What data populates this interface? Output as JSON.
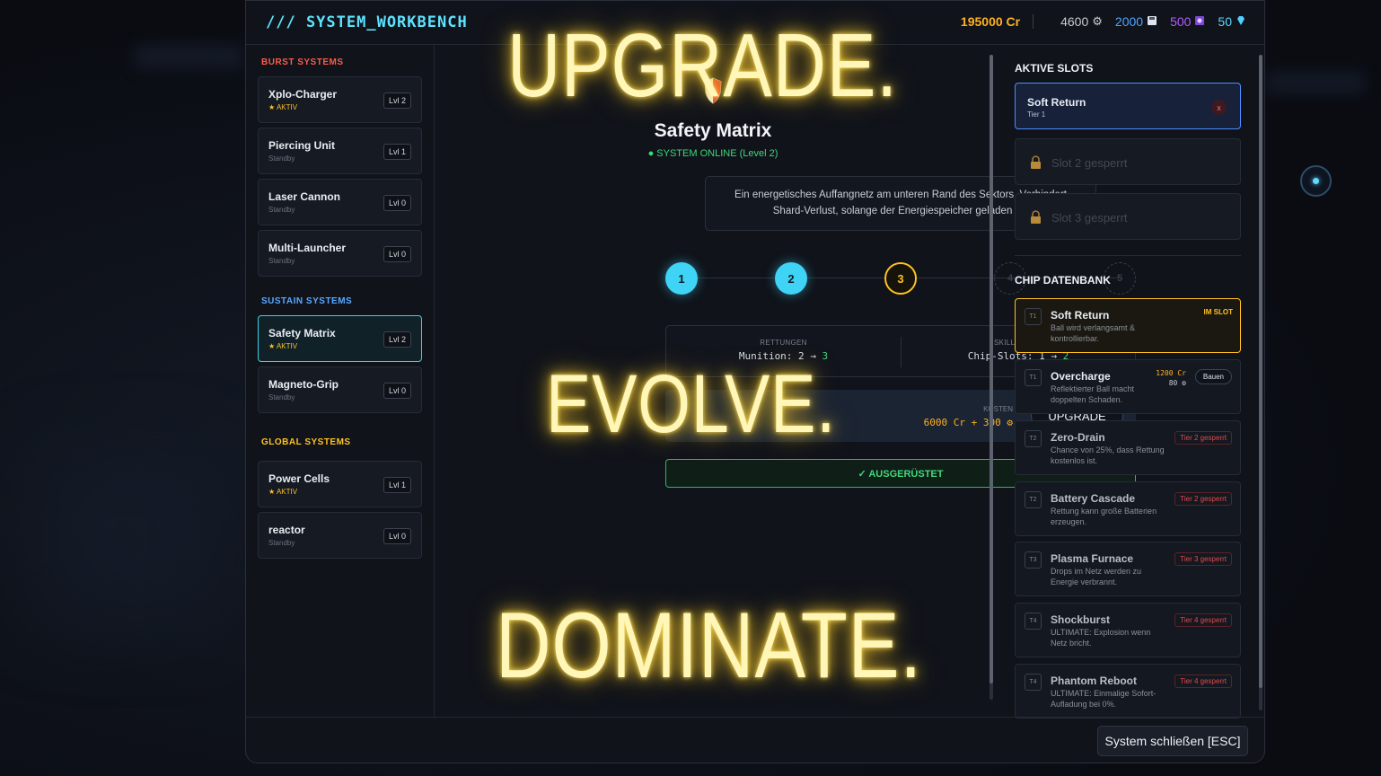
{
  "header": {
    "title": "/// SYSTEM_WORKBENCH",
    "credits": "195000 Cr",
    "resources": [
      {
        "value": "4600",
        "icon": "gear-icon"
      },
      {
        "value": "2000",
        "icon": "chip-icon"
      },
      {
        "value": "500",
        "icon": "core-icon"
      },
      {
        "value": "50",
        "icon": "diamond-icon"
      }
    ]
  },
  "sidebar": {
    "categories": {
      "burst": "BURST SYSTEMS",
      "sustain": "SUSTAIN SYSTEMS",
      "global": "GLOBAL SYSTEMS"
    },
    "items": [
      {
        "name": "Xplo-Charger",
        "status": "★ AKTIV",
        "level": "Lvl 2"
      },
      {
        "name": "Piercing Unit",
        "status": "Standby",
        "level": "Lvl 1"
      },
      {
        "name": "Laser Cannon",
        "status": "Standby",
        "level": "Lvl 0"
      },
      {
        "name": "Multi-Launcher",
        "status": "Standby",
        "level": "Lvl 0"
      },
      {
        "name": "Safety Matrix",
        "status": "★ AKTIV",
        "level": "Lvl 2"
      },
      {
        "name": "Magneto-Grip",
        "status": "Standby",
        "level": "Lvl 0"
      },
      {
        "name": "Power Cells",
        "status": "★ AKTIV",
        "level": "Lvl 1"
      },
      {
        "name": "reactor",
        "status": "Standby",
        "level": "Lvl 0"
      }
    ]
  },
  "module": {
    "title": "Safety Matrix",
    "status": "● SYSTEM ONLINE (Level 2)",
    "description": "Ein energetisches Auffangnetz am unteren Rand des Sektors. Verhindert Shard-Verlust, solange der Energiespeicher geladen ist.",
    "steps": [
      "1",
      "2",
      "3",
      "4",
      "5"
    ],
    "stat_left_label": "RETTUNGEN",
    "stat_left_value": "Munition: 2 → ",
    "stat_left_next": "3",
    "stat_right_label": "SKILL-SLOTS",
    "stat_right_value": "Chip-Slots: 1 → ",
    "stat_right_next": "2",
    "cost_label": "KOSTEN",
    "cost_value": "6000 Cr + 300 ⚙",
    "upgrade_label": "UPGRADE",
    "equipped_label": "✓ AUSGERÜSTET"
  },
  "slots": {
    "title": "AKTIVE SLOTS",
    "active": {
      "name": "Soft Return",
      "tier": "Tier 1",
      "remove": "x"
    },
    "locked": [
      "Slot 2 gesperrt",
      "Slot 3 gesperrt"
    ]
  },
  "chips": {
    "title": "CHIP DATENBANK",
    "items": [
      {
        "tier": "T1",
        "name": "Soft Return",
        "desc": "Ball wird verlangsamt & kontrollierbar.",
        "tag": "IM SLOT"
      },
      {
        "tier": "T1",
        "name": "Overcharge",
        "desc": "Reflektierter Ball macht doppelten Schaden.",
        "cost_cr": "1200 Cr",
        "cost_scrap": "80 ⚙",
        "button": "Bauen"
      },
      {
        "tier": "T2",
        "name": "Zero-Drain",
        "desc": "Chance von 25%, dass Rettung kostenlos ist.",
        "tag": "Tier 2 gesperrt"
      },
      {
        "tier": "T2",
        "name": "Battery Cascade",
        "desc": "Rettung kann große Batterien erzeugen.",
        "tag": "Tier 2 gesperrt"
      },
      {
        "tier": "T3",
        "name": "Plasma Furnace",
        "desc": "Drops im Netz werden zu Energie verbrannt.",
        "tag": "Tier 3 gesperrt"
      },
      {
        "tier": "T4",
        "name": "Shockburst",
        "desc": "ULTIMATE: Explosion wenn Netz bricht.",
        "tag": "Tier 4 gesperrt"
      },
      {
        "tier": "T4",
        "name": "Phantom Reboot",
        "desc": "ULTIMATE: Einmalige Sofort-Aufladung bei 0%.",
        "tag": "Tier 4 gesperrt"
      }
    ]
  },
  "footer": {
    "close_label": "System schließen [ESC]"
  },
  "overlay": {
    "word1": "UPGRADE.",
    "word2": "EVOLVE.",
    "word3": "DOMINATE."
  },
  "colors": {
    "accent": "#5ee3ff",
    "credits": "#ffb11e",
    "glow": "#ffe25a",
    "online": "#3ed97a"
  }
}
